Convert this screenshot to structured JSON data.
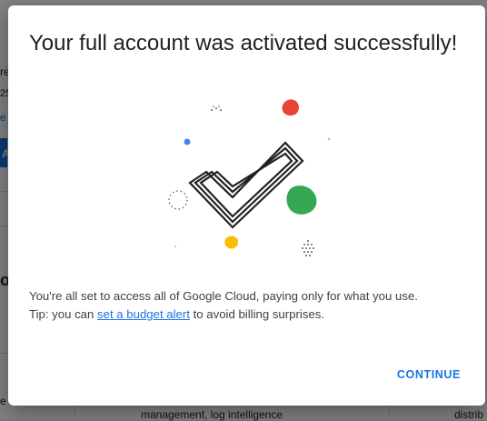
{
  "background": {
    "fragments": [
      "re",
      "25",
      "e",
      "A",
      "o",
      "e",
      "management, log intelligence",
      "distrib"
    ]
  },
  "dialog": {
    "title": "Your full account was activated successfully!",
    "message_line1": "You're all set to access all of Google Cloud, paying only for what you use.",
    "tip_prefix": "Tip: you can ",
    "tip_link": "set a budget alert",
    "tip_suffix": " to avoid billing surprises.",
    "continue_label": "CONTINUE"
  },
  "illustration": {
    "icon": "checkmark-icon",
    "colors": {
      "red": "#ea4335",
      "blue": "#4285f4",
      "green": "#34a853",
      "yellow": "#fbbc04",
      "stroke": "#202124"
    }
  },
  "colors": {
    "accent": "#1a73e8",
    "text": "#202124",
    "muted": "#3c4043"
  }
}
